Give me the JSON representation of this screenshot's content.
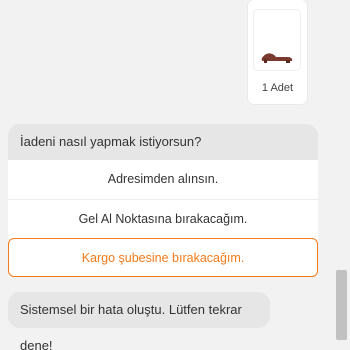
{
  "product": {
    "quantity_label": "1 Adet",
    "image_icon": "sandal-product-image"
  },
  "question": {
    "text": "İadeni nasıl yapmak istiyorsun?"
  },
  "options": [
    {
      "label": "Adresimden alınsın.",
      "selected": false
    },
    {
      "label": "Gel Al Noktasına bırakacağım.",
      "selected": false
    },
    {
      "label": "Kargo şubesine bırakacağım.",
      "selected": true
    }
  ],
  "error": {
    "text": "Sistemsel bir hata oluştu. Lütfen tekrar dene!"
  },
  "colors": {
    "accent": "#f27a1a",
    "bubble": "#e6e6e6",
    "background": "#f2f2f2"
  }
}
